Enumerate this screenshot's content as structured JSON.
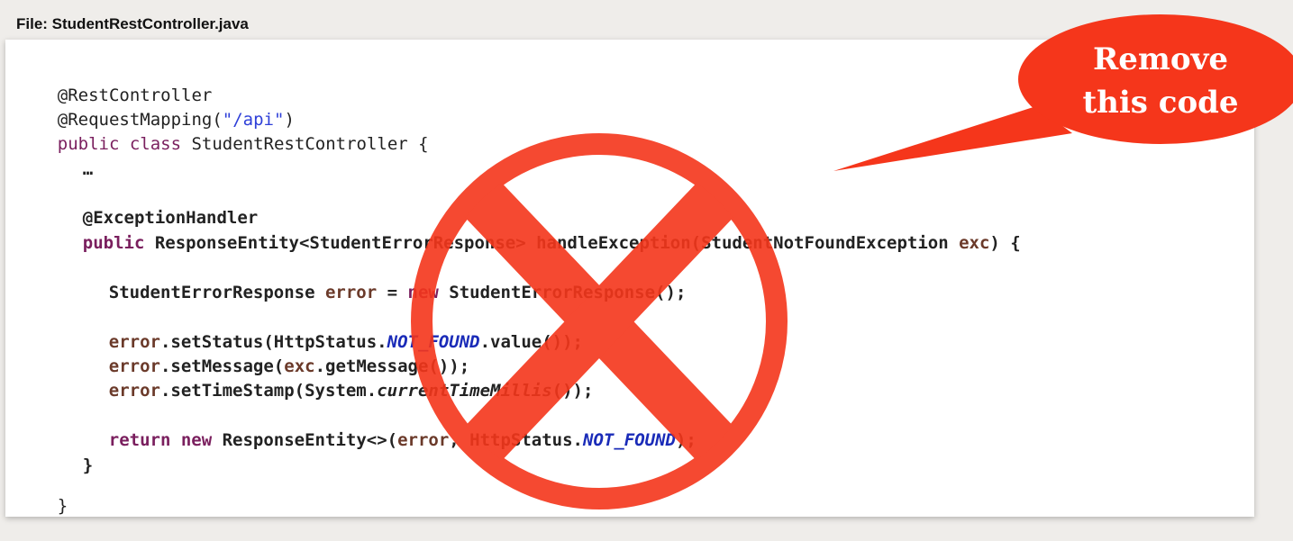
{
  "file_label": "File: StudentRestController.java",
  "callout": {
    "line1": "Remove",
    "line2": "this code",
    "color": "#f5361b"
  },
  "prohibition_color": "#f5361b",
  "code": {
    "l1": "@RestController",
    "l2_a": "@RequestMapping(",
    "l2_b": "\"/api\"",
    "l2_c": ")",
    "l3_a": "public class ",
    "l3_b": "StudentRestController {",
    "l4": "…",
    "l5": "@ExceptionHandler",
    "l6_a": "public ",
    "l6_b": "ResponseEntity<StudentErrorResponse> handleException(StudentNotFoundException ",
    "l6_c": "exc",
    "l6_d": ") {",
    "l7_a": "StudentErrorResponse ",
    "l7_b": "error",
    "l7_c": " = ",
    "l7_d": "new ",
    "l7_e": "StudentErrorResponse();",
    "l8_a": "error",
    "l8_b": ".setStatus(HttpStatus.",
    "l8_c": "NOT_FOUND",
    "l8_d": ".value());",
    "l9_a": "error",
    "l9_b": ".setMessage(",
    "l9_c": "exc",
    "l9_d": ".getMessage());",
    "l10_a": "error",
    "l10_b": ".setTimeStamp(System.",
    "l10_c": "currentTimeMillis",
    "l10_d": "());",
    "l11_a": "return new ",
    "l11_b": "ResponseEntity<>(",
    "l11_c": "error",
    "l11_d": ", HttpStatus.",
    "l11_e": "NOT_FOUND",
    "l11_f": ");",
    "l12": "}",
    "l13": "}"
  }
}
